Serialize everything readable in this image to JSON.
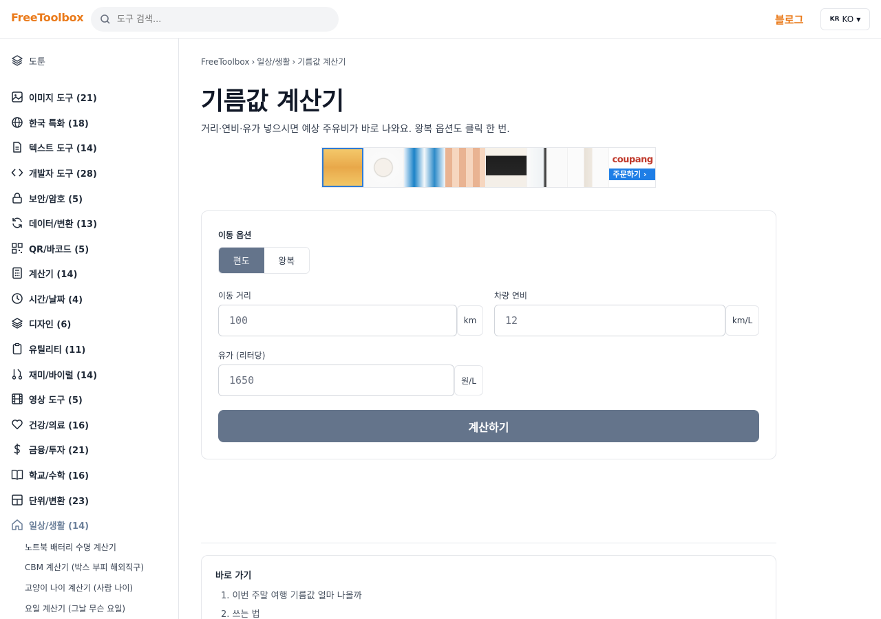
{
  "header": {
    "logo": "FreeToolbox",
    "search_placeholder": "도구 검색...",
    "blog": "블로그",
    "lang_flag": "KR",
    "lang_code": "KO"
  },
  "sidebar": {
    "top_label": "도툰",
    "items": [
      {
        "label": "이미지 도구 (21)",
        "icon": "image-icon"
      },
      {
        "label": "한국 특화 (18)",
        "icon": "globe-icon"
      },
      {
        "label": "텍스트 도구 (14)",
        "icon": "document-icon"
      },
      {
        "label": "개발자 도구 (28)",
        "icon": "code-icon"
      },
      {
        "label": "보안/암호 (5)",
        "icon": "lock-icon"
      },
      {
        "label": "데이터/변환 (13)",
        "icon": "refresh-icon"
      },
      {
        "label": "QR/바코드 (5)",
        "icon": "qr-icon"
      },
      {
        "label": "계산기 (14)",
        "icon": "calculator-icon"
      },
      {
        "label": "시간/날짜 (4)",
        "icon": "clock-icon"
      },
      {
        "label": "디자인 (6)",
        "icon": "layers-icon"
      },
      {
        "label": "유틸리티 (11)",
        "icon": "clipboard-icon"
      },
      {
        "label": "재미/바이럴 (14)",
        "icon": "branch-icon"
      },
      {
        "label": "영상 도구 (5)",
        "icon": "film-icon"
      },
      {
        "label": "건강/의료 (16)",
        "icon": "heart-icon"
      },
      {
        "label": "금융/투자 (21)",
        "icon": "dollar-icon"
      },
      {
        "label": "학교/수학 (16)",
        "icon": "book-icon"
      },
      {
        "label": "단위/변환 (23)",
        "icon": "grid-icon"
      },
      {
        "label": "일상/생활 (14)",
        "icon": "home-icon"
      }
    ],
    "sub_items": [
      "노트북 배터리 수명 계산기",
      "CBM 계산기 (박스 부피 해외직구)",
      "고양이 나이 계산기 (사람 나이)",
      "요일 계산기 (그날 무슨 요일)"
    ]
  },
  "breadcrumb": [
    "FreeToolbox",
    "일상/생활",
    "기름값 계산기"
  ],
  "breadcrumb_sep": "›",
  "page": {
    "title": "기름값 계산기",
    "subtitle": "거리·연비·유가 넣으시면 예상 주유비가 바로 나와요. 왕복 옵션도 클릭 한 번."
  },
  "ad": {
    "brand": "coupang",
    "order": "주문하기 ›"
  },
  "form": {
    "trip_label": "이동 옵션",
    "one_way": "편도",
    "round_trip": "왕복",
    "distance_label": "이동 거리",
    "distance_placeholder": "100",
    "distance_unit": "km",
    "efficiency_label": "차량 연비",
    "efficiency_placeholder": "12",
    "efficiency_unit": "km/L",
    "price_label": "유가 (리터당)",
    "price_placeholder": "1650",
    "price_unit": "원/L",
    "calculate": "계산하기"
  },
  "toc": {
    "heading": "바로 가기",
    "items": [
      "1. 이번 주말 여행 기름값 얼마 나올까",
      "2. 쓰는 법"
    ]
  }
}
